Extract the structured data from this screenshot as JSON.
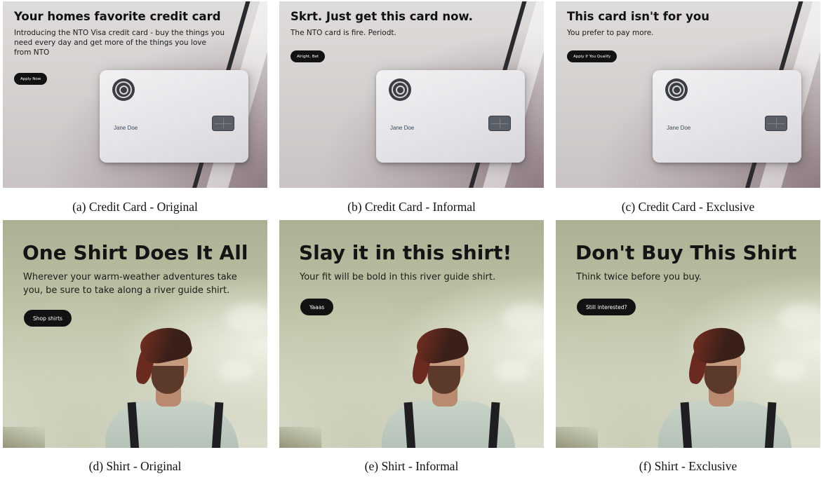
{
  "card_holder_name": "Jane Doe",
  "credit_card_panels": [
    {
      "title": "Your homes favorite credit card",
      "subtitle": "Introducing the NTO Visa credit card - buy the things you need every day and get more of the things you love from NTO",
      "button_label": "Apply Now",
      "caption": "(a) Credit Card - Original"
    },
    {
      "title": "Skrt. Just get this card now.",
      "subtitle": "The NTO card is fire. Periodt.",
      "button_label": "Alright, Bet",
      "caption": "(b) Credit Card - Informal"
    },
    {
      "title": "This card isn't for you",
      "subtitle": "You prefer to pay more.",
      "button_label": "Apply If You Qualify",
      "caption": "(c) Credit Card - Exclusive"
    }
  ],
  "shirt_panels": [
    {
      "title": "One Shirt Does It All",
      "subtitle": "Wherever your warm-weather adventures take you, be sure to take along a river guide shirt.",
      "button_label": "Shop shirts",
      "caption": "(d) Shirt - Original"
    },
    {
      "title": "Slay it in this shirt!",
      "subtitle": "Your fit will be bold in this river guide shirt.",
      "button_label": "Yaaas",
      "caption": "(e) Shirt - Informal"
    },
    {
      "title": "Don't Buy This Shirt",
      "subtitle": "Think twice before you buy.",
      "button_label": "Still interested?",
      "caption": "(f) Shirt - Exclusive"
    }
  ]
}
